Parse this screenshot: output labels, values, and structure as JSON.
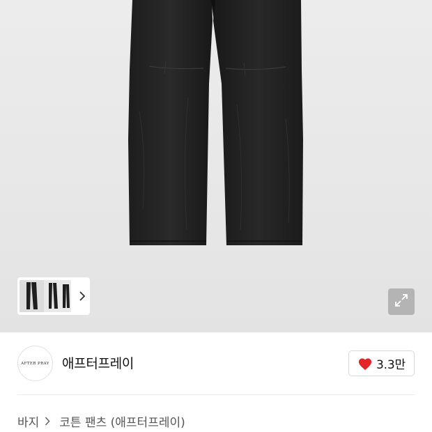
{
  "brand": {
    "logo_text": "AFTER PRAY",
    "name": "애프터프레이"
  },
  "like": {
    "count": "3.3만",
    "color": "#e3262a"
  },
  "breadcrumb": {
    "category": "바지",
    "product": "코튼 팬츠 (애프터프레이)"
  },
  "icons": {
    "thumbnail_next": "chevron-right-icon",
    "expand": "expand-icon",
    "like": "heart-icon",
    "breadcrumb_separator": "chevron-right-icon"
  }
}
